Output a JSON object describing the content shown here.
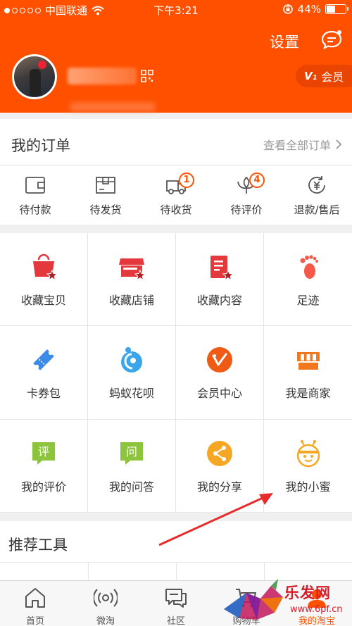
{
  "status_bar": {
    "carrier": "中国联通",
    "time": "下午3:21",
    "battery": "44%",
    "signal_bars_filled": 1,
    "signal_bars_total": 5,
    "battery_level": 0.44
  },
  "header": {
    "settings_label": "设置",
    "member_label": "会员",
    "member_badge_icon": "vip-v-icon",
    "accent_color": "#ff5000"
  },
  "orders": {
    "title": "我的订单",
    "view_all": "查看全部订单",
    "items": [
      {
        "label": "待付款",
        "icon": "wallet-icon",
        "badge": ""
      },
      {
        "label": "待发货",
        "icon": "box-icon",
        "badge": ""
      },
      {
        "label": "待收货",
        "icon": "truck-icon",
        "badge": "1"
      },
      {
        "label": "待评价",
        "icon": "flower-icon",
        "badge": "4"
      },
      {
        "label": "退款/售后",
        "icon": "refund-icon",
        "badge": ""
      }
    ]
  },
  "grid": {
    "items": [
      {
        "label": "收藏宝贝",
        "icon": "bag-star-icon"
      },
      {
        "label": "收藏店铺",
        "icon": "store-star-icon"
      },
      {
        "label": "收藏内容",
        "icon": "document-star-icon"
      },
      {
        "label": "足迹",
        "icon": "footprint-icon"
      },
      {
        "label": "卡券包",
        "icon": "ticket-icon"
      },
      {
        "label": "蚂蚁花呗",
        "icon": "huabei-icon"
      },
      {
        "label": "会员中心",
        "icon": "member-v-icon"
      },
      {
        "label": "我是商家",
        "icon": "shop-icon"
      },
      {
        "label": "我的评价",
        "icon": "review-icon",
        "glyph": "评"
      },
      {
        "label": "我的问答",
        "icon": "qa-icon",
        "glyph": "问"
      },
      {
        "label": "我的分享",
        "icon": "share-icon"
      },
      {
        "label": "我的小蜜",
        "icon": "bee-icon"
      }
    ]
  },
  "recommended": {
    "title": "推荐工具"
  },
  "tabbar": {
    "items": [
      {
        "label": "首页",
        "icon": "home-icon"
      },
      {
        "label": "微淘",
        "icon": "broadcast-icon"
      },
      {
        "label": "社区",
        "icon": "chat-icon"
      },
      {
        "label": "购物车",
        "icon": "cart-icon"
      },
      {
        "label": "我的淘宝",
        "icon": "profile-icon"
      }
    ]
  },
  "watermark": {
    "brand": "乐发网",
    "url": "www.6pf.cn"
  }
}
